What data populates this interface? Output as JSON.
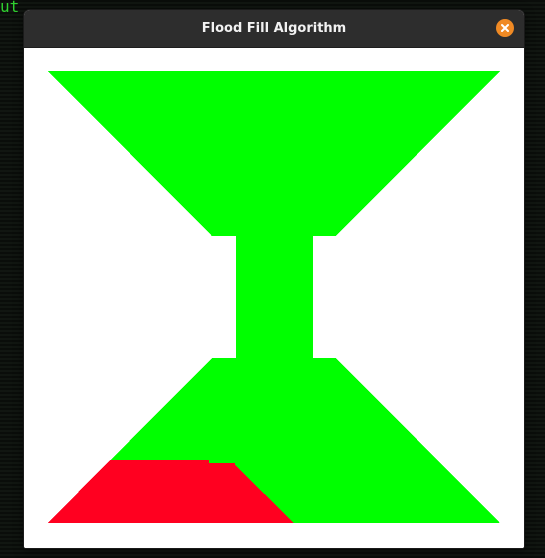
{
  "terminal": {
    "fragment": "ut"
  },
  "window": {
    "title": "Flood Fill Algorithm",
    "close_icon": "close-icon"
  },
  "canvas": {
    "background": "#ffffff",
    "outline_fill_color": "#00ff00",
    "flood_fill_color": "#ff0020"
  }
}
